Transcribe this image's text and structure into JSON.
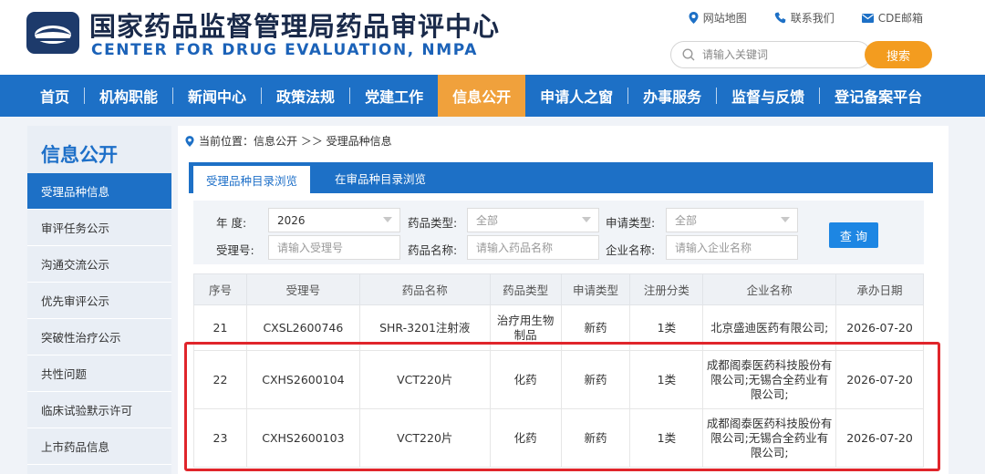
{
  "header": {
    "title": "国家药品监督管理局药品审评中心",
    "subtitle": "CENTER FOR DRUG EVALUATION, NMPA",
    "links": [
      "网站地图",
      "联系我们",
      "CDE邮箱"
    ],
    "search_placeholder": "请输入关键词",
    "search_button": "搜索"
  },
  "nav": {
    "items": [
      "首页",
      "机构职能",
      "新闻中心",
      "政策法规",
      "党建工作",
      "信息公开",
      "申请人之窗",
      "办事服务",
      "监督与反馈",
      "登记备案平台"
    ],
    "active_index": 5
  },
  "sidebar": {
    "title": "信息公开",
    "items": [
      "受理品种信息",
      "审评任务公示",
      "沟通交流公示",
      "优先审评公示",
      "突破性治疗公示",
      "共性问题",
      "临床试验默示许可",
      "上市药品信息"
    ]
  },
  "breadcrumb": {
    "text": "当前位置：信息公开 ＞＞ 受理品种信息"
  },
  "tabs": [
    "受理品种目录浏览",
    "在审品种目录浏览"
  ],
  "filter": {
    "year_label": "年  度:",
    "year_value": "2026",
    "drug_type_label": "药品类型:",
    "drug_type_value": "全部",
    "app_type_label": "申请类型:",
    "app_type_value": "全部",
    "accept_no_label": "受理号:",
    "accept_no_placeholder": "请输入受理号",
    "drug_name_label": "药品名称:",
    "drug_name_placeholder": "请输入药品名称",
    "company_label": "企业名称:",
    "company_placeholder": "请输入企业名称",
    "query_button": "查 询"
  },
  "table": {
    "headers": [
      "序号",
      "受理号",
      "药品名称",
      "药品类型",
      "申请类型",
      "注册分类",
      "企业名称",
      "承办日期"
    ],
    "rows": [
      [
        "21",
        "CXSL2600746",
        "SHR-3201注射液",
        "治疗用生物制品",
        "新药",
        "1类",
        "北京盛迪医药有限公司;",
        "2026-07-20"
      ],
      [
        "22",
        "CXHS2600104",
        "VCT220片",
        "化药",
        "新药",
        "1类",
        "成都阁泰医药科技股份有限公司;无锡合全药业有限公司;",
        "2026-07-20"
      ],
      [
        "23",
        "CXHS2600103",
        "VCT220片",
        "化药",
        "新药",
        "1类",
        "成都阁泰医药科技股份有限公司;无锡合全药业有限公司;",
        "2026-07-20"
      ]
    ]
  },
  "colors": {
    "nav_blue": "#1d70c6",
    "accent_orange": "#f0a13c",
    "highlight_red": "#e0252b"
  }
}
